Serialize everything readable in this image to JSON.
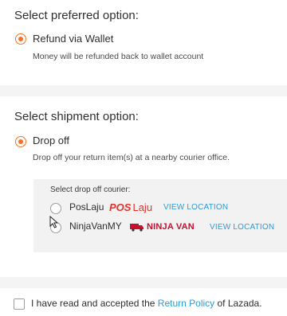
{
  "preferred_option": {
    "heading": "Select preferred option:",
    "refund_label": "Refund via Wallet",
    "refund_desc": "Money will be refunded back to wallet account"
  },
  "shipment_option": {
    "heading": "Select shipment option:",
    "dropoff_label": "Drop off",
    "dropoff_desc": "Drop off your return item(s) at a nearby courier office.",
    "courier_box": {
      "title": "Select drop off courier:",
      "couriers": [
        {
          "name": "PosLaju",
          "logo_main": "POS",
          "logo_sub": "Laju",
          "view_label": "VIEW LOCATION"
        },
        {
          "name": "NinjaVanMY",
          "logo_text": "NINJA VAN",
          "view_label": "VIEW LOCATION"
        }
      ]
    }
  },
  "terms": {
    "prefix": "I have read and accepted the ",
    "link": "Return Policy",
    "suffix": " of Lazada."
  },
  "colors": {
    "accent": "#f57224",
    "link": "#2b9bd7",
    "poslaju_red": "#e3322b",
    "ninjavan_red": "#c8102e"
  }
}
